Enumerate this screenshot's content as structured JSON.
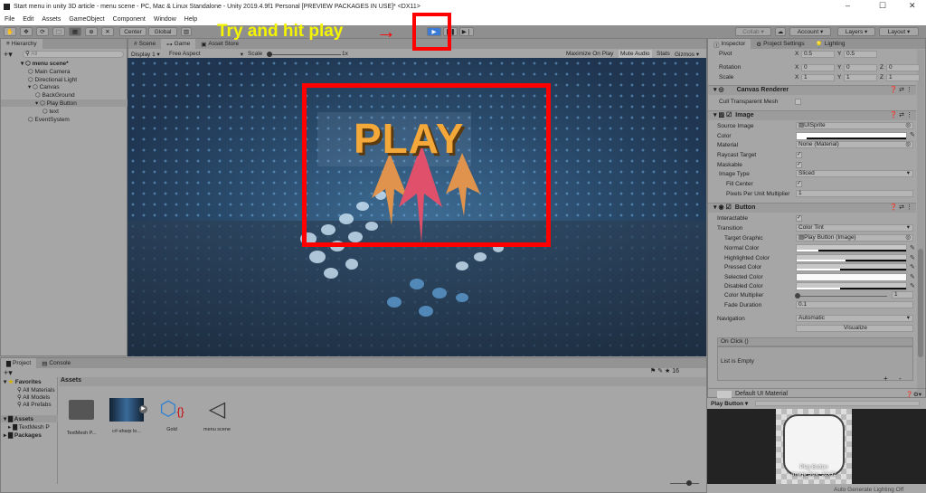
{
  "window": {
    "title": "Start menu in unity 3D article - menu scene - PC, Mac & Linux Standalone - Unity 2019.4.9f1 Personal [PREVIEW PACKAGES IN USE]* <DX11>",
    "minimize": "–",
    "maximize": "☐",
    "close": "✕"
  },
  "menu": [
    "File",
    "Edit",
    "Assets",
    "GameObject",
    "Component",
    "Window",
    "Help"
  ],
  "toolbar": {
    "center": "Center",
    "global": "Global",
    "collab": "Collab ▾",
    "account": "Account ▾",
    "layers": "Layers ▾",
    "layout": "Layout ▾",
    "play": "▶",
    "pause": "❚❚",
    "step": "▶❘"
  },
  "annotation": {
    "text": "Try and hit play",
    "arrow": "→",
    "accent": "#ff0000",
    "text_color": "#f5f500"
  },
  "hierarchy": {
    "tab": "Hierarchy",
    "search_placeholder": "All",
    "items": [
      {
        "label": "menu scene*",
        "depth": 0
      },
      {
        "label": "Main Camera",
        "depth": 1
      },
      {
        "label": "Directional Light",
        "depth": 1
      },
      {
        "label": "Canvas",
        "depth": 1
      },
      {
        "label": "BackGround",
        "depth": 2
      },
      {
        "label": "Play Button",
        "depth": 2
      },
      {
        "label": "text",
        "depth": 3
      },
      {
        "label": "EventSystem",
        "depth": 1
      }
    ]
  },
  "game": {
    "tabs": [
      "Scene",
      "Game",
      "Asset Store"
    ],
    "display": "Display 1",
    "aspect": "Free Aspect",
    "scale_label": "Scale",
    "scale_value": "1x",
    "maximize": "Maximize On Play",
    "mute": "Mute Audio",
    "stats": "Stats",
    "gizmos": "Gizmos",
    "button_text": "PLAY"
  },
  "inspector": {
    "tabs": [
      "Inspector",
      "Project Settings",
      "Lighting"
    ],
    "transform": {
      "pivot": "Pivot",
      "pivot_x": "0.5",
      "pivot_y": "0.5",
      "rotation": "Rotation",
      "rot": [
        "0",
        "0",
        "0"
      ],
      "scale": "Scale",
      "scl": [
        "1",
        "1",
        "1"
      ]
    },
    "canvas_renderer": {
      "title": "Canvas Renderer",
      "cull": "Cull Transparent Mesh"
    },
    "image": {
      "title": "Image",
      "source_label": "Source Image",
      "source": "UISprite",
      "color_label": "Color",
      "material_label": "Material",
      "material": "None (Material)",
      "raycast": "Raycast Target",
      "maskable": "Maskable",
      "type_label": "Image Type",
      "type": "Sliced",
      "fill": "Fill Center",
      "ppu_label": "Pixels Per Unit Multiplier",
      "ppu": "1"
    },
    "button": {
      "title": "Button",
      "interactable": "Interactable",
      "transition_label": "Transition",
      "transition": "Color Tint",
      "target_label": "Target Graphic",
      "target": "Play Button (Image)",
      "normal": "Normal Color",
      "highlighted": "Highlighted Color",
      "pressed": "Pressed Color",
      "selected": "Selected Color",
      "disabled": "Disabled Color",
      "multiplier_label": "Color Multiplier",
      "multiplier": "1",
      "fade_label": "Fade Duration",
      "fade": "0.1",
      "navigation_label": "Navigation",
      "navigation": "Automatic",
      "visualize": "Visualize",
      "onclick": "On Click ()",
      "empty": "List is Empty",
      "add": "+",
      "remove": "-"
    },
    "material": "Default UI Material",
    "preview": {
      "title": "Play Button ▾",
      "caption1": "Play Button",
      "caption2": "Image Size: 32x32"
    }
  },
  "project": {
    "tabs": [
      "Project",
      "Console"
    ],
    "favorites": "Favorites",
    "fav_items": [
      "All Materials",
      "All Models",
      "All Prefabs"
    ],
    "assets": "Assets",
    "asset_children": [
      "TextMesh P"
    ],
    "packages": "Packages",
    "breadcrumb": "Assets",
    "count": "16",
    "files": [
      {
        "name": "TextMesh P...",
        "icon": "folder"
      },
      {
        "name": "c#-sharp lo...",
        "icon": "video"
      },
      {
        "name": "Gold",
        "icon": "script"
      },
      {
        "name": "menu scene",
        "icon": "unity"
      }
    ]
  },
  "status": "Auto Generate Lighting Off"
}
